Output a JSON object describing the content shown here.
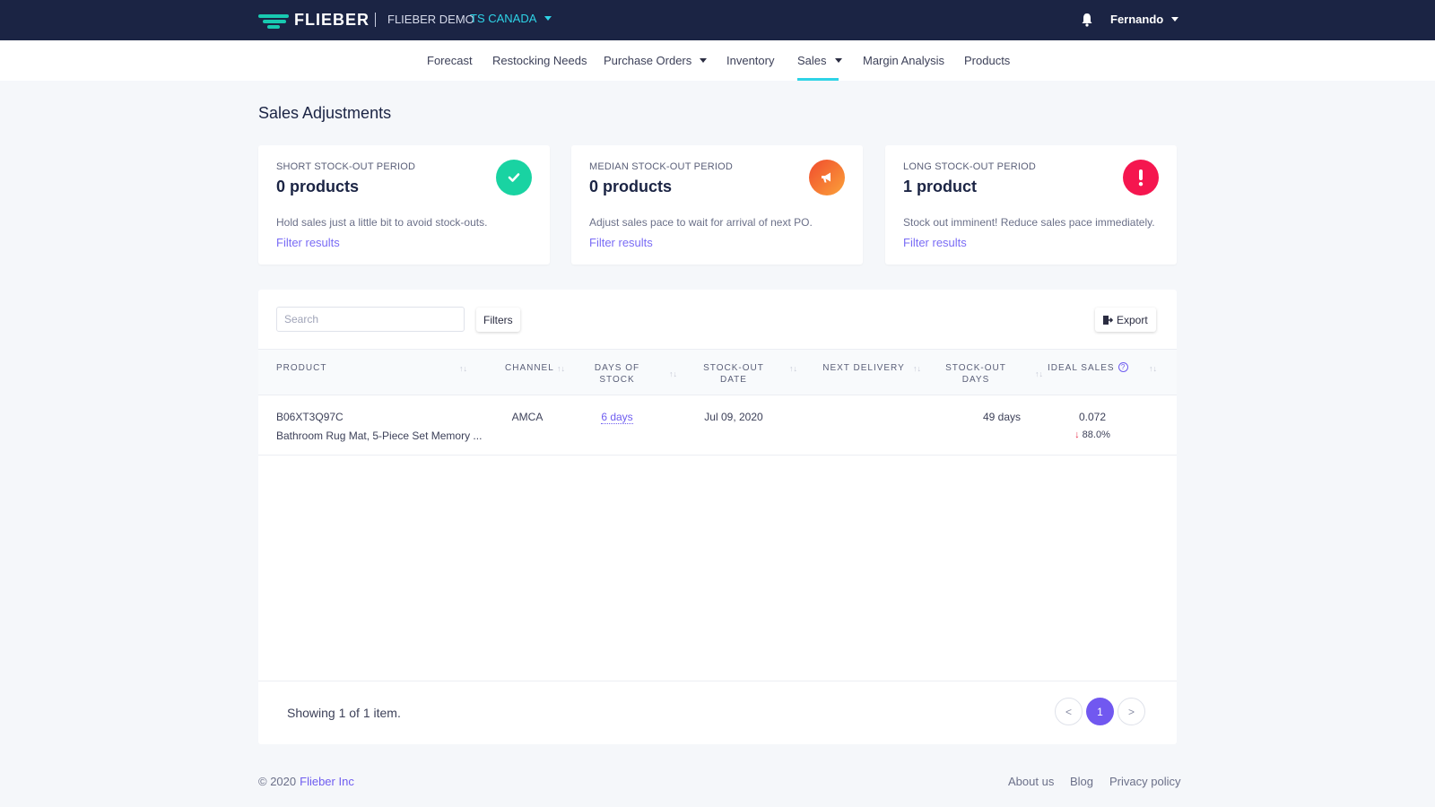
{
  "topbar": {
    "logo_text": "FLIEBER",
    "demo_label": "FLIEBER DEMO",
    "account": "TS CANADA",
    "user": "Fernando",
    "icons": {
      "logo": "flieber-logo-icon",
      "notifications": "bell-icon",
      "dropdown": "caret-down-icon"
    }
  },
  "nav": {
    "items": [
      {
        "label": "Forecast"
      },
      {
        "label": "Restocking Needs"
      },
      {
        "label": "Purchase Orders"
      },
      {
        "label": "Inventory"
      },
      {
        "label": "Sales"
      },
      {
        "label": "Margin Analysis"
      },
      {
        "label": "Products"
      }
    ],
    "active": "Sales",
    "accent_color": "#2ed3e6"
  },
  "page": {
    "title": "Sales Adjustments"
  },
  "cards": [
    {
      "label": "SHORT STOCK-OUT PERIOD",
      "value": "0 products",
      "description": "Hold sales just a little bit to avoid stock-outs.",
      "link": "Filter results",
      "icon": "check-icon",
      "color": "#19d3a2"
    },
    {
      "label": "MEDIAN STOCK-OUT PERIOD",
      "value": "0 products",
      "description": "Adjust sales pace to wait for arrival of next PO.",
      "link": "Filter results",
      "icon": "megaphone-icon",
      "color": "#fb6a36"
    },
    {
      "label": "LONG STOCK-OUT PERIOD",
      "value": "1 product",
      "description": "Stock out imminent! Reduce sales pace immediately.",
      "link": "Filter results",
      "icon": "exclamation-icon",
      "color": "#f5164f"
    }
  ],
  "table": {
    "search_placeholder": "Search",
    "filters_label": "Filters",
    "export_label": "Export",
    "columns": {
      "product": "PRODUCT",
      "channel": "CHANNEL",
      "days_of_stock_1": "DAYS OF",
      "days_of_stock_2": "STOCK",
      "stockout_date": "STOCK-OUT DATE",
      "next_delivery": "NEXT DELIVERY",
      "stockout_days_1": "STOCK-OUT",
      "stockout_days_2": "DAYS",
      "ideal_sales": "IDEAL SALES"
    },
    "sort_glyph": "↑↓",
    "rows": [
      {
        "sku": "B06XT3Q97C",
        "name": "Bathroom Rug Mat, 5-Piece Set Memory ...",
        "channel": "AMCA",
        "days_of_stock": "6 days",
        "stockout_date": "Jul 09, 2020",
        "next_delivery": "",
        "stockout_days": "49 days",
        "ideal_sales": "0.072",
        "ideal_change": "88.0%"
      }
    ]
  },
  "pagination": {
    "summary": "Showing 1 of 1 item.",
    "prev": "<",
    "next": ">",
    "current": "1",
    "active_color": "#7158f0"
  },
  "footer": {
    "copyright": "© 2020",
    "company": "Flieber Inc",
    "links": [
      "About us",
      "Blog",
      "Privacy policy"
    ]
  }
}
